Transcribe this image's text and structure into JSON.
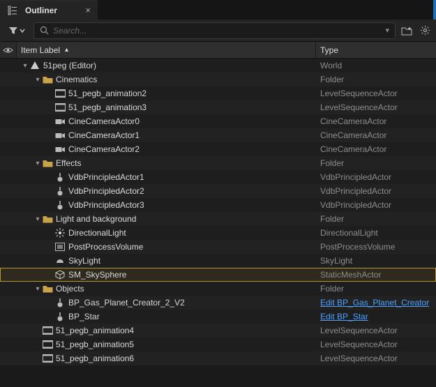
{
  "panel": {
    "title": "Outliner"
  },
  "search": {
    "placeholder": "Search..."
  },
  "columns": {
    "item": "Item Label",
    "type": "Type"
  },
  "colors": {
    "folder": "#caa24a",
    "link": "#4da3ff",
    "selectedOutline": "#b59536"
  },
  "rows": [
    {
      "indent": 0,
      "disclose": "down",
      "icon": "world",
      "label": "51peg (Editor)",
      "type": "World",
      "link": false,
      "selected": false
    },
    {
      "indent": 1,
      "disclose": "down",
      "icon": "folder",
      "label": "Cinematics",
      "type": "Folder",
      "link": false,
      "selected": false
    },
    {
      "indent": 2,
      "disclose": "",
      "icon": "sequence",
      "label": "51_pegb_animation2",
      "type": "LevelSequenceActor",
      "link": false,
      "selected": false
    },
    {
      "indent": 2,
      "disclose": "",
      "icon": "sequence",
      "label": "51_pegb_animation3",
      "type": "LevelSequenceActor",
      "link": false,
      "selected": false
    },
    {
      "indent": 2,
      "disclose": "",
      "icon": "camera",
      "label": "CineCameraActor0",
      "type": "CineCameraActor",
      "link": false,
      "selected": false
    },
    {
      "indent": 2,
      "disclose": "",
      "icon": "camera",
      "label": "CineCameraActor1",
      "type": "CineCameraActor",
      "link": false,
      "selected": false
    },
    {
      "indent": 2,
      "disclose": "",
      "icon": "camera",
      "label": "CineCameraActor2",
      "type": "CineCameraActor",
      "link": false,
      "selected": false
    },
    {
      "indent": 1,
      "disclose": "down",
      "icon": "folder",
      "label": "Effects",
      "type": "Folder",
      "link": false,
      "selected": false
    },
    {
      "indent": 2,
      "disclose": "",
      "icon": "vdb",
      "label": "VdbPrincipledActor1",
      "type": "VdbPrincipledActor",
      "link": false,
      "selected": false
    },
    {
      "indent": 2,
      "disclose": "",
      "icon": "vdb",
      "label": "VdbPrincipledActor2",
      "type": "VdbPrincipledActor",
      "link": false,
      "selected": false
    },
    {
      "indent": 2,
      "disclose": "",
      "icon": "vdb",
      "label": "VdbPrincipledActor3",
      "type": "VdbPrincipledActor",
      "link": false,
      "selected": false
    },
    {
      "indent": 1,
      "disclose": "down",
      "icon": "folder",
      "label": "Light and background",
      "type": "Folder",
      "link": false,
      "selected": false
    },
    {
      "indent": 2,
      "disclose": "",
      "icon": "light",
      "label": "DirectionalLight",
      "type": "DirectionalLight",
      "link": false,
      "selected": false
    },
    {
      "indent": 2,
      "disclose": "",
      "icon": "postproc",
      "label": "PostProcessVolume",
      "type": "PostProcessVolume",
      "link": false,
      "selected": false
    },
    {
      "indent": 2,
      "disclose": "",
      "icon": "skylight",
      "label": "SkyLight",
      "type": "SkyLight",
      "link": false,
      "selected": false
    },
    {
      "indent": 2,
      "disclose": "",
      "icon": "mesh",
      "label": "SM_SkySphere",
      "type": "StaticMeshActor",
      "link": false,
      "selected": true
    },
    {
      "indent": 1,
      "disclose": "down",
      "icon": "folder",
      "label": "Objects",
      "type": "Folder",
      "link": false,
      "selected": false
    },
    {
      "indent": 2,
      "disclose": "",
      "icon": "bp",
      "label": "BP_Gas_Planet_Creator_2_V2",
      "type": "Edit BP_Gas_Planet_Creator",
      "link": true,
      "selected": false
    },
    {
      "indent": 2,
      "disclose": "",
      "icon": "bp",
      "label": "BP_Star",
      "type": "Edit BP_Star",
      "link": true,
      "selected": false
    },
    {
      "indent": 1,
      "disclose": "",
      "icon": "sequence",
      "label": "51_pegb_animation4",
      "type": "LevelSequenceActor",
      "link": false,
      "selected": false
    },
    {
      "indent": 1,
      "disclose": "",
      "icon": "sequence",
      "label": "51_pegb_animation5",
      "type": "LevelSequenceActor",
      "link": false,
      "selected": false
    },
    {
      "indent": 1,
      "disclose": "",
      "icon": "sequence",
      "label": "51_pegb_animation6",
      "type": "LevelSequenceActor",
      "link": false,
      "selected": false
    }
  ]
}
